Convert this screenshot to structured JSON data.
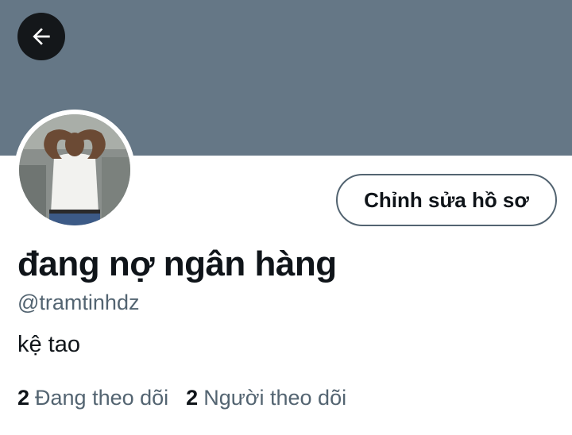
{
  "header": {
    "banner_color": "#657786",
    "back_icon": "arrow-left-icon"
  },
  "profile": {
    "display_name": "đang nợ ngân hàng",
    "handle": "@tramtinhdz",
    "bio": "kệ tao",
    "edit_button_label": "Chỉnh sửa hồ sơ",
    "following_count": "2",
    "following_label": "Đang theo dõi",
    "followers_count": "2",
    "followers_label": "Người theo dõi"
  }
}
